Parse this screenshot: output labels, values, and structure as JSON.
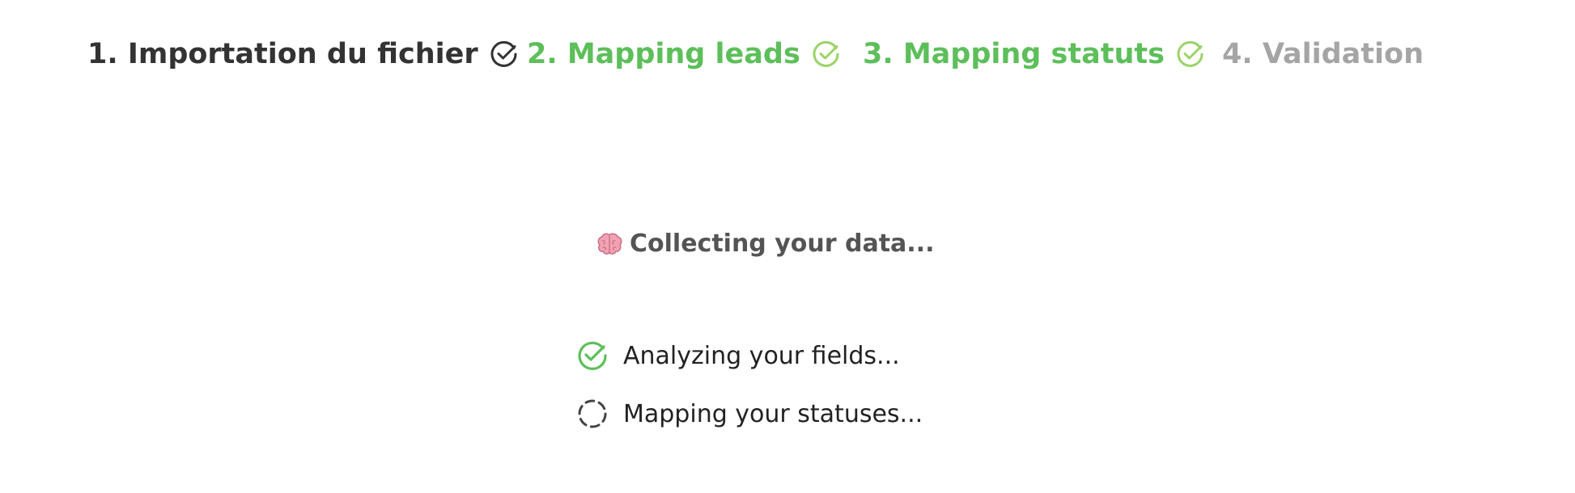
{
  "stepper": {
    "steps": [
      {
        "label": "1. Importation du fichier",
        "state": "completed",
        "icon": "check-circle-icon",
        "color": "#333333"
      },
      {
        "label": "2. Mapping leads",
        "state": "completed",
        "icon": "check-circle-icon",
        "color": "#5DBF5A"
      },
      {
        "label": "3. Mapping statuts",
        "state": "completed",
        "icon": "check-circle-icon",
        "color": "#5DBF5A"
      },
      {
        "label": "4. Validation",
        "state": "pending",
        "color": "#A5A5A5"
      }
    ]
  },
  "status": {
    "icon": "brain-icon",
    "title": "Collecting your data..."
  },
  "tasks": [
    {
      "label": "Analyzing your fields...",
      "state": "done",
      "icon": "check-circle-icon",
      "color": "#5DBF5A"
    },
    {
      "label": "Mapping your statuses...",
      "state": "in-progress",
      "icon": "loading-spinner-icon",
      "color": "#444444"
    }
  ]
}
